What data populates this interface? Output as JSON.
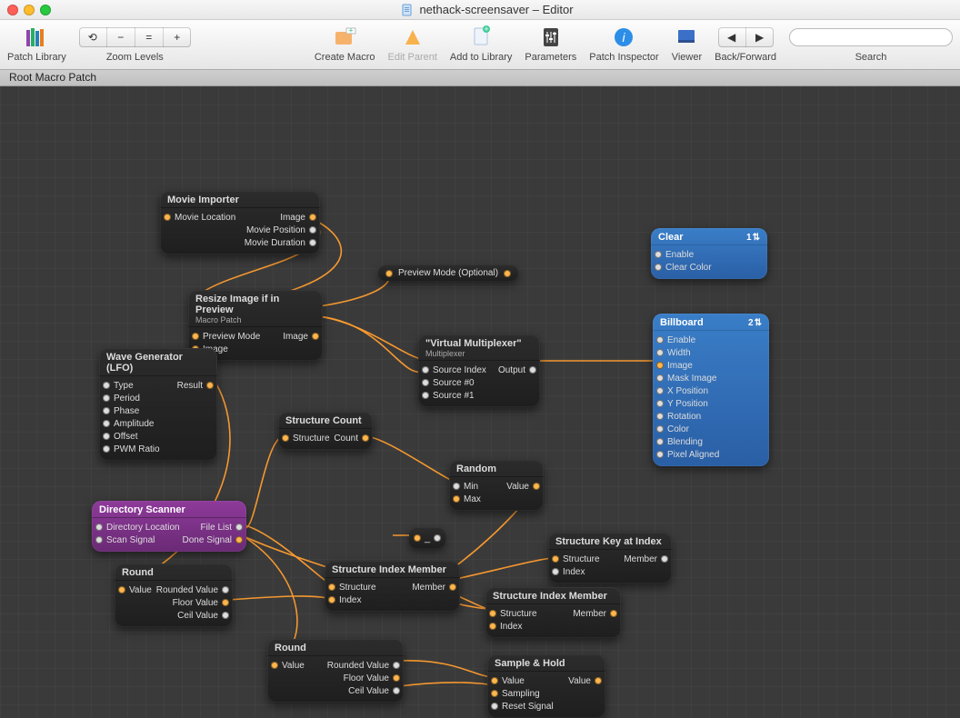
{
  "window": {
    "title": "nethack-screensaver – Editor"
  },
  "toolbar": {
    "patch_library": "Patch Library",
    "zoom_levels": "Zoom Levels",
    "create_macro": "Create Macro",
    "edit_parent": "Edit Parent",
    "add_to_library": "Add to Library",
    "parameters": "Parameters",
    "patch_inspector": "Patch Inspector",
    "viewer": "Viewer",
    "back_forward": "Back/Forward",
    "search_label": "Search",
    "search_placeholder": ""
  },
  "breadcrumb": "Root Macro Patch",
  "preview_pill": "Preview Mode (Optional)",
  "nodes": {
    "movie_importer": {
      "title": "Movie Importer",
      "in": [
        "Movie Location"
      ],
      "out": [
        "Image",
        "Movie Position",
        "Movie Duration"
      ]
    },
    "resize": {
      "title": "Resize Image if in Preview",
      "subtitle": "Macro Patch",
      "in": [
        "Preview Mode",
        "Image"
      ],
      "out": [
        "Image"
      ]
    },
    "wave": {
      "title": "Wave Generator (LFO)",
      "in": [
        "Type",
        "Period",
        "Phase",
        "Amplitude",
        "Offset",
        "PWM Ratio"
      ],
      "out": [
        "Result"
      ]
    },
    "vmux": {
      "title": "\"Virtual Multiplexer\"",
      "subtitle": "Multiplexer",
      "in": [
        "Source Index",
        "Source #0",
        "Source #1"
      ],
      "out": [
        "Output"
      ]
    },
    "structure_count": {
      "title": "Structure Count",
      "in": [
        "Structure"
      ],
      "out": [
        "Count"
      ]
    },
    "random": {
      "title": "Random",
      "in": [
        "Min",
        "Max"
      ],
      "out": [
        "Value"
      ]
    },
    "dir_scanner": {
      "title": "Directory Scanner",
      "in": [
        "Directory Location",
        "Scan Signal"
      ],
      "out": [
        "File List",
        "Done Signal"
      ]
    },
    "round1": {
      "title": "Round",
      "in": [
        "Value"
      ],
      "out": [
        "Rounded Value",
        "Floor Value",
        "Ceil Value"
      ]
    },
    "sim1": {
      "title": "Structure Index Member",
      "in": [
        "Structure",
        "Index"
      ],
      "out": [
        "Member"
      ]
    },
    "ski": {
      "title": "Structure Key at Index",
      "in": [
        "Structure",
        "Index"
      ],
      "out": [
        "Member"
      ]
    },
    "sim2": {
      "title": "Structure Index Member",
      "in": [
        "Structure",
        "Index"
      ],
      "out": [
        "Member"
      ]
    },
    "round2": {
      "title": "Round",
      "in": [
        "Value"
      ],
      "out": [
        "Rounded Value",
        "Floor Value",
        "Ceil Value"
      ]
    },
    "sample_hold": {
      "title": "Sample & Hold",
      "in": [
        "Value",
        "Sampling",
        "Reset Signal"
      ],
      "out": [
        "Value"
      ]
    },
    "clear": {
      "title": "Clear",
      "badge": "1",
      "in": [
        "Enable",
        "Clear Color"
      ]
    },
    "billboard": {
      "title": "Billboard",
      "badge": "2",
      "in": [
        "Enable",
        "Width",
        "Image",
        "Mask Image",
        "X Position",
        "Y Position",
        "Rotation",
        "Color",
        "Blending",
        "Pixel Aligned"
      ]
    }
  },
  "mini": {
    "label": "_"
  }
}
